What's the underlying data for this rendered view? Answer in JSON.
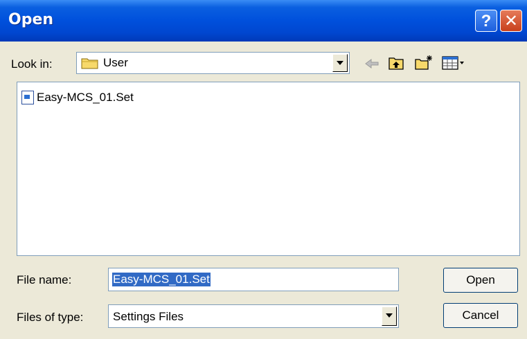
{
  "window": {
    "title": "Open",
    "help_glyph": "?",
    "close_glyph": "✕"
  },
  "look_in": {
    "label": "Look in:",
    "value": "User",
    "icon": "folder-icon"
  },
  "toolbar": {
    "icons": [
      "back-arrow-icon",
      "up-folder-icon",
      "new-folder-icon",
      "view-menu-icon"
    ]
  },
  "files": [
    {
      "name": "Easy-MCS_01.Set",
      "icon": "settings-file-icon"
    }
  ],
  "file_name": {
    "label": "File name:",
    "value": "Easy-MCS_01.Set"
  },
  "file_type": {
    "label": "Files of type:",
    "value": "Settings Files"
  },
  "buttons": {
    "open": "Open",
    "cancel": "Cancel"
  },
  "colors": {
    "titlebar": "#0050dc",
    "selection": "#316ac5",
    "dialog_bg": "#ece9d8"
  }
}
